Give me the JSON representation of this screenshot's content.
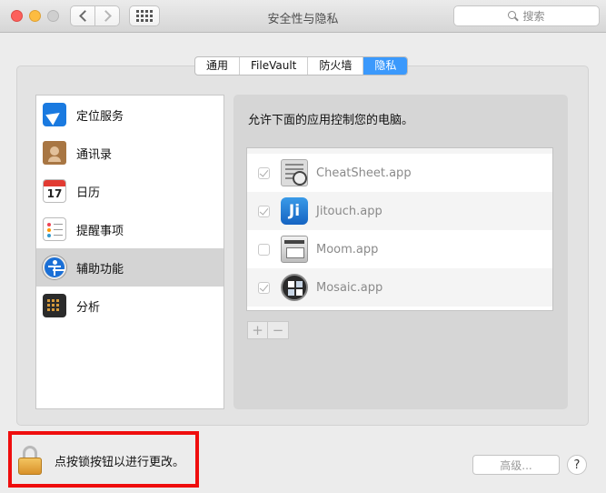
{
  "window": {
    "title": "安全性与隐私",
    "search_placeholder": "搜索"
  },
  "tabs": [
    {
      "label": "通用",
      "active": false
    },
    {
      "label": "FileVault",
      "active": false
    },
    {
      "label": "防火墙",
      "active": false
    },
    {
      "label": "隐私",
      "active": true
    }
  ],
  "sidebar": {
    "items": [
      {
        "label": "定位服务",
        "icon": "location-arrow-icon"
      },
      {
        "label": "通讯录",
        "icon": "contacts-book-icon"
      },
      {
        "label": "日历",
        "icon": "calendar-icon",
        "day": "17"
      },
      {
        "label": "提醒事项",
        "icon": "reminders-list-icon"
      },
      {
        "label": "辅助功能",
        "icon": "accessibility-icon",
        "selected": true
      },
      {
        "label": "分析",
        "icon": "analytics-grid-icon"
      }
    ]
  },
  "content": {
    "description": "允许下面的应用控制您的电脑。",
    "apps": [
      {
        "name": "CheatSheet.app",
        "checked": true,
        "icon": "cheatsheet-app-icon"
      },
      {
        "name": "Jitouch.app",
        "checked": true,
        "icon": "jitouch-app-icon",
        "icon_text": "Ji"
      },
      {
        "name": "Moom.app",
        "checked": false,
        "icon": "moom-app-icon"
      },
      {
        "name": "Mosaic.app",
        "checked": true,
        "icon": "mosaic-app-icon"
      }
    ],
    "add_label": "+",
    "remove_label": "−"
  },
  "footer": {
    "lock_text": "点按锁按钮以进行更改。",
    "advanced_label": "高级...",
    "help_label": "?"
  },
  "colors": {
    "accent": "#3b99fc",
    "highlight_box": "#ef0d0d"
  }
}
